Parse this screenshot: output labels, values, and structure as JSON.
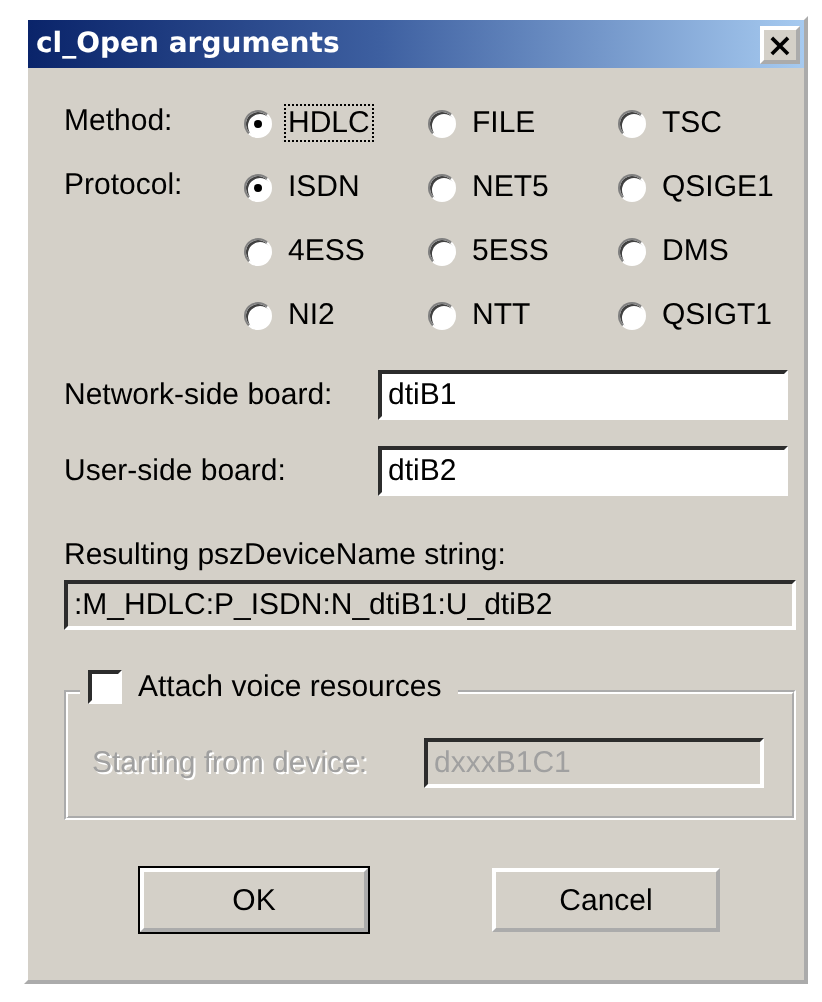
{
  "window": {
    "title": "cl_Open arguments",
    "close": "×"
  },
  "radio_groups": [
    {
      "label": "Method:",
      "options": [
        {
          "label": "HDLC",
          "selected": true,
          "focused": true
        },
        {
          "label": "FILE",
          "selected": false,
          "focused": false
        },
        {
          "label": "TSC",
          "selected": false,
          "focused": false
        }
      ]
    },
    {
      "label": "Protocol:",
      "options": [
        {
          "label": "ISDN",
          "selected": true,
          "focused": false
        },
        {
          "label": "NET5",
          "selected": false,
          "focused": false
        },
        {
          "label": "QSIGE1",
          "selected": false,
          "focused": false
        },
        {
          "label": "4ESS",
          "selected": false,
          "focused": false
        },
        {
          "label": "5ESS",
          "selected": false,
          "focused": false
        },
        {
          "label": "DMS",
          "selected": false,
          "focused": false
        },
        {
          "label": "NI2",
          "selected": false,
          "focused": false
        },
        {
          "label": "NTT",
          "selected": false,
          "focused": false
        },
        {
          "label": "QSIGT1",
          "selected": false,
          "focused": false
        }
      ]
    }
  ],
  "fields": [
    {
      "label": "Network-side board:",
      "value": "dtiB1"
    },
    {
      "label": "User-side board:",
      "value": "dtiB2"
    }
  ],
  "result": {
    "label": "Resulting pszDeviceName string:",
    "value": ":M_HDLC:P_ISDN:N_dtiB1:U_dtiB2"
  },
  "voice": {
    "label": "Attach voice resources",
    "checked": false,
    "field": {
      "label": "Starting from device:",
      "value": "dxxxB1C1",
      "disabled": true
    }
  },
  "buttons": [
    {
      "label": "OK",
      "default": true
    },
    {
      "label": "Cancel",
      "default": false
    }
  ]
}
